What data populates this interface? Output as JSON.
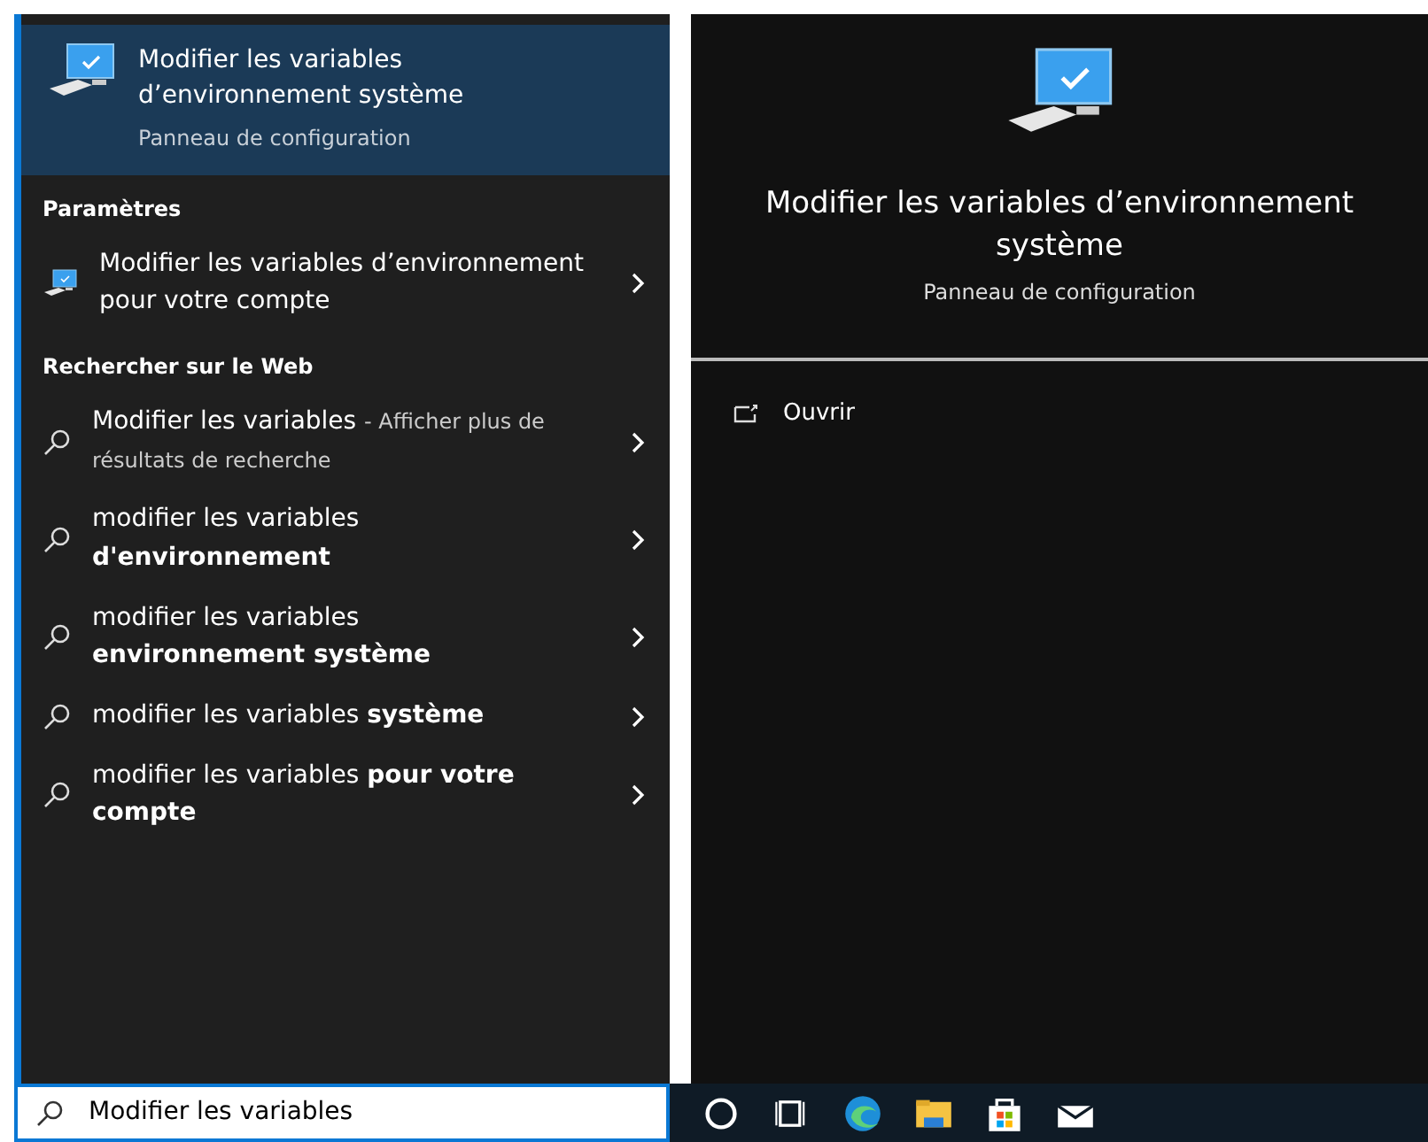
{
  "best_match": {
    "title": "Modifier les variables d’environnement système",
    "subtitle": "Panneau de configuration",
    "selected": true
  },
  "sections": [
    {
      "heading": "Paramètres",
      "items": [
        {
          "kind": "settings",
          "text": "Modifier les variables d’environnement pour votre compte"
        }
      ]
    },
    {
      "heading": "Rechercher sur le Web",
      "items": [
        {
          "kind": "web",
          "text": "Modifier les variables",
          "extra": "- Afficher plus de résultats de recherche"
        },
        {
          "kind": "web",
          "text": "modifier les variables **d'environnement**"
        },
        {
          "kind": "web",
          "text": "modifier les variables **environnement système**"
        },
        {
          "kind": "web",
          "text": "modifier les variables **système**"
        },
        {
          "kind": "web",
          "text": "modifier les variables **pour votre compte**"
        }
      ]
    }
  ],
  "preview": {
    "title": "Modifier les variables d’environnement système",
    "subtitle": "Panneau de configuration",
    "actions": [
      "Ouvrir"
    ]
  },
  "search": {
    "value": "Modifier les variables"
  },
  "taskbar": [
    {
      "kind": "cortana"
    },
    {
      "kind": "taskview"
    },
    {
      "kind": "browser"
    },
    {
      "kind": "folder"
    },
    {
      "kind": "store"
    },
    {
      "kind": "mail"
    }
  ]
}
